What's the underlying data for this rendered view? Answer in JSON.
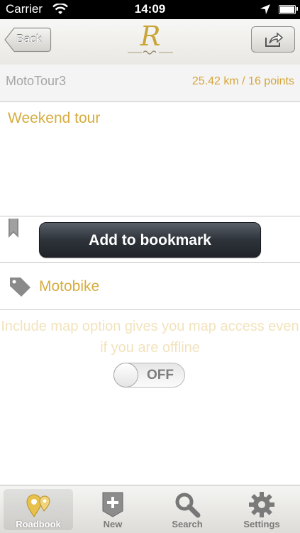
{
  "status_bar": {
    "carrier": "Carrier",
    "time": "14:09"
  },
  "nav": {
    "back_label": "Back",
    "logo_letter": "R"
  },
  "tour": {
    "name": "MotoTour3",
    "stats": "25.42 km / 16 points",
    "description": "Weekend tour"
  },
  "bookmark": {
    "button_label": "Add to bookmark"
  },
  "tag": {
    "label": "Motobike"
  },
  "map_option": {
    "note": "Include map option gives you map access even if you are offline",
    "toggle_state": "OFF"
  },
  "tabs": [
    {
      "label": "Roadbook",
      "icon": "map-pin-icon",
      "active": true
    },
    {
      "label": "New",
      "icon": "add-icon",
      "active": false
    },
    {
      "label": "Search",
      "icon": "search-icon",
      "active": false
    },
    {
      "label": "Settings",
      "icon": "gear-icon",
      "active": false
    }
  ],
  "colors": {
    "accent": "#d6ad3f",
    "muted_accent": "#f2e3bd",
    "dark_button": "#2e333a"
  }
}
